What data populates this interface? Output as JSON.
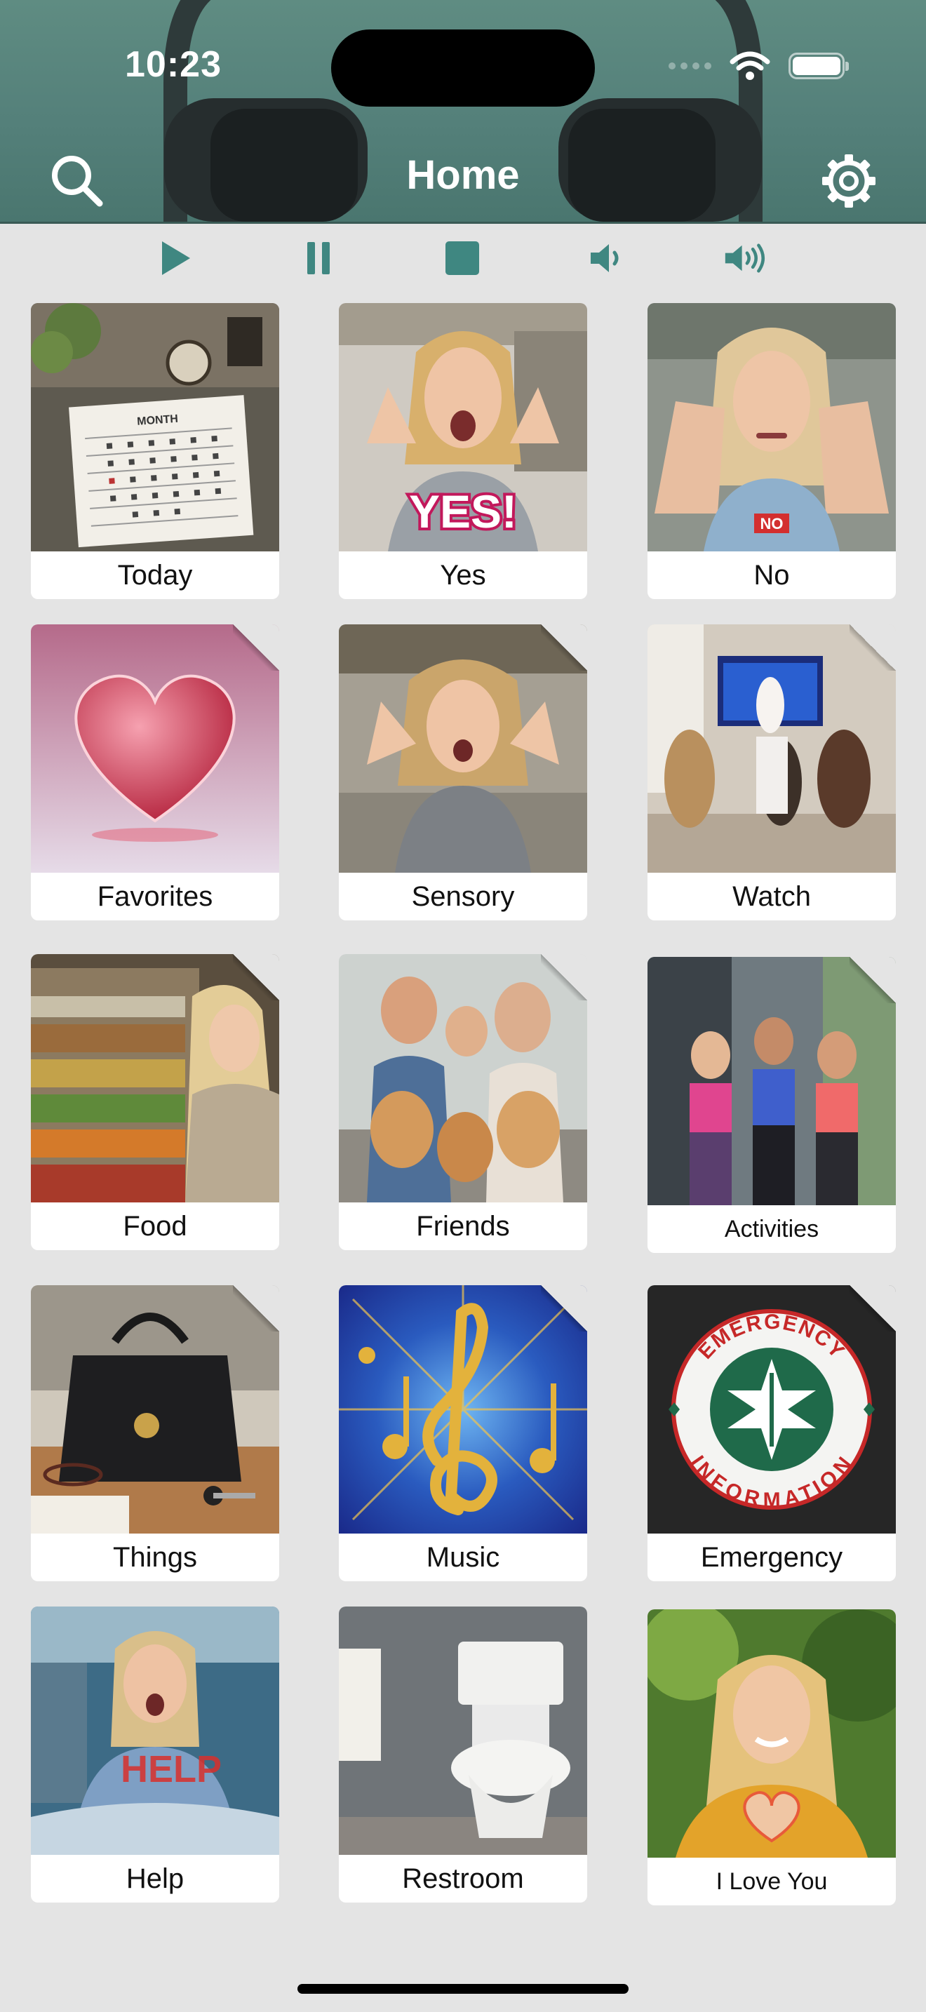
{
  "status": {
    "time": "10:23"
  },
  "nav": {
    "title": "Home",
    "left_icon": "search-icon",
    "right_icon": "gear-icon"
  },
  "toolbar": {
    "buttons": [
      "play-icon",
      "pause-icon",
      "stop-icon",
      "volume-down-icon",
      "volume-up-icon"
    ]
  },
  "colors": {
    "header": "#54807a",
    "accent": "#3f8781",
    "background": "#e4e4e4"
  },
  "tiles": [
    {
      "label": "Today",
      "folder": false
    },
    {
      "label": "Yes",
      "folder": false
    },
    {
      "label": "No",
      "folder": false
    },
    {
      "label": "Favorites",
      "folder": true
    },
    {
      "label": "Sensory",
      "folder": true
    },
    {
      "label": "Watch",
      "folder": true
    },
    {
      "label": "Food",
      "folder": true
    },
    {
      "label": "Friends",
      "folder": true
    },
    {
      "label": "Activities",
      "folder": true
    },
    {
      "label": "Things",
      "folder": true
    },
    {
      "label": "Music",
      "folder": true
    },
    {
      "label": "Emergency",
      "folder": true
    },
    {
      "label": "Help",
      "folder": false
    },
    {
      "label": "Restroom",
      "folder": false
    },
    {
      "label": "I Love You",
      "folder": false
    }
  ],
  "image_text": {
    "calendar_month": "MONTH",
    "yes_sign": "YES!",
    "no_sign": "NO",
    "help_text": "HELP",
    "emergency_badge": "EMERGENCY INFORMATION"
  }
}
